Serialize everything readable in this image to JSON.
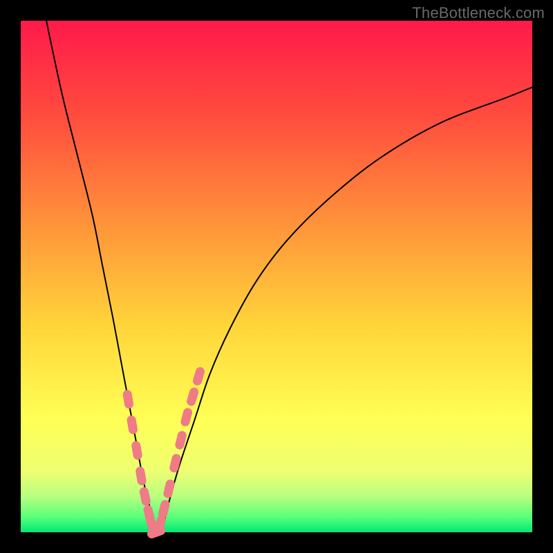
{
  "watermark": "TheBottleneck.com",
  "colors": {
    "frame": "#000000",
    "curve": "#000000",
    "marker_fill": "#ee7b86",
    "marker_stroke": "#ee7b86",
    "gradient_stops": [
      {
        "pct": 0,
        "color": "#ff1a4a"
      },
      {
        "pct": 18,
        "color": "#ff4a3e"
      },
      {
        "pct": 40,
        "color": "#ff943a"
      },
      {
        "pct": 60,
        "color": "#ffd63a"
      },
      {
        "pct": 78,
        "color": "#ffff55"
      },
      {
        "pct": 88,
        "color": "#eeff70"
      },
      {
        "pct": 93,
        "color": "#b8ff80"
      },
      {
        "pct": 97,
        "color": "#5aff7a"
      },
      {
        "pct": 100,
        "color": "#00e874"
      }
    ]
  },
  "chart_data": {
    "type": "line",
    "title": "",
    "xlabel": "",
    "ylabel": "",
    "xlim": [
      0,
      100
    ],
    "ylim": [
      0,
      100
    ],
    "note": "V-shaped bottleneck curve. x is normalized across plot width; y is bottleneck percentage (0 at bottom, 100 at top). Values estimated from pixel positions.",
    "series": [
      {
        "name": "bottleneck-curve",
        "x": [
          5,
          8,
          11,
          14,
          16,
          18,
          19.5,
          21,
          22.5,
          24,
          25.5,
          27,
          28,
          29,
          31,
          34,
          37,
          41,
          46,
          52,
          60,
          70,
          82,
          95,
          100
        ],
        "y": [
          100,
          86,
          74,
          62,
          52,
          42,
          34,
          26,
          18,
          10,
          4,
          0,
          2,
          6,
          13,
          22,
          31,
          40,
          49,
          57,
          65,
          73,
          80,
          85,
          87
        ]
      }
    ],
    "markers": {
      "name": "highlighted-points",
      "note": "Pink capsule markers clustered near the minimum on both arms of the V.",
      "x": [
        21.0,
        21.8,
        22.7,
        23.5,
        24.3,
        25.1,
        25.8,
        26.5,
        27.2,
        28.0,
        29.0,
        30.2,
        31.3,
        32.4,
        33.6,
        34.8
      ],
      "y": [
        26.0,
        21.0,
        16.0,
        11.0,
        7.0,
        3.5,
        1.0,
        0.0,
        1.5,
        4.5,
        8.5,
        13.5,
        18.0,
        22.5,
        26.5,
        30.5
      ]
    }
  }
}
